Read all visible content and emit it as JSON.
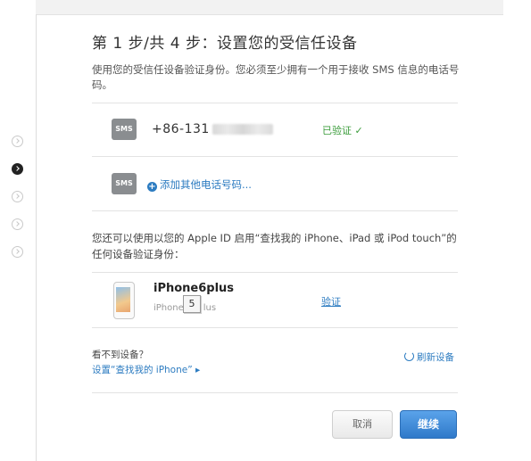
{
  "header": {
    "title": "第 1 步/共 4 步：设置您的受信任设备",
    "description": "使用您的受信任设备验证身份。您必须至少拥有一个用于接收 SMS 信息的电话号码。"
  },
  "sms_section": {
    "badge": "SMS",
    "phone_number": "+86-131",
    "verified_label": "已验证 ✓",
    "add_badge": "SMS",
    "add_phone_label": "添加其他电话号码..."
  },
  "devices_section": {
    "description": "您还可以使用以您的 Apple ID 启用“查找我的 iPhone、iPad 或 iPod touch”的任何设备验证身份：",
    "device_name": "iPhone6plus",
    "device_sub_left": "iPhone",
    "device_sub_right": "lus",
    "tag": "5",
    "verify_label": "验证"
  },
  "footer_links": {
    "cant_see": "看不到设备？",
    "setup_find_iphone": "设置“查找我的 iPhone” ▸",
    "refresh": "刷新设备"
  },
  "buttons": {
    "cancel": "取消",
    "continue": "继续"
  },
  "colors": {
    "accent": "#2d7cc1",
    "verified": "#3a9c3a",
    "primary_button": "#2f79c9"
  }
}
